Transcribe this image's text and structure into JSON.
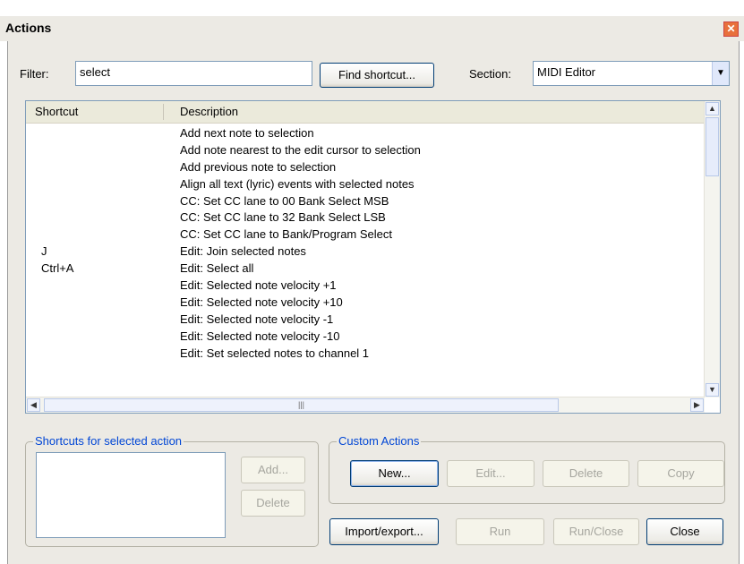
{
  "window": {
    "title": "Actions",
    "close_glyph": "✕"
  },
  "filter": {
    "label": "Filter:",
    "value": "select"
  },
  "find_shortcut_label": "Find shortcut...",
  "section": {
    "label": "Section:",
    "value": "MIDI Editor"
  },
  "table": {
    "columns": [
      "Shortcut",
      "Description"
    ],
    "rows": [
      {
        "shortcut": "",
        "description": "Add next note to selection"
      },
      {
        "shortcut": "",
        "description": "Add note nearest to the edit cursor to selection"
      },
      {
        "shortcut": "",
        "description": "Add previous note to selection"
      },
      {
        "shortcut": "",
        "description": "Align all text (lyric) events with selected notes"
      },
      {
        "shortcut": "",
        "description": "CC: Set CC lane to 00 Bank Select MSB"
      },
      {
        "shortcut": "",
        "description": "CC: Set CC lane to 32 Bank Select LSB"
      },
      {
        "shortcut": "",
        "description": "CC: Set CC lane to Bank/Program Select"
      },
      {
        "shortcut": "J",
        "description": "Edit: Join selected notes"
      },
      {
        "shortcut": "Ctrl+A",
        "description": "Edit: Select all"
      },
      {
        "shortcut": "",
        "description": "Edit: Selected note velocity +1"
      },
      {
        "shortcut": "",
        "description": "Edit: Selected note velocity +10"
      },
      {
        "shortcut": "",
        "description": "Edit: Selected note velocity -1"
      },
      {
        "shortcut": "",
        "description": "Edit: Selected note velocity -10"
      },
      {
        "shortcut": "",
        "description": "Edit: Set selected notes to channel 1"
      }
    ]
  },
  "shortcuts_group": {
    "title": "Shortcuts for selected action",
    "add_label": "Add...",
    "delete_label": "Delete"
  },
  "custom_group": {
    "title": "Custom Actions",
    "new_label": "New...",
    "edit_label": "Edit...",
    "delete_label": "Delete",
    "copy_label": "Copy"
  },
  "footer": {
    "import_export_label": "Import/export...",
    "run_label": "Run",
    "run_close_label": "Run/Close",
    "close_label": "Close"
  },
  "icons": {
    "dropdown": "chevron-down-icon",
    "scroll_up": "scroll-up-icon",
    "scroll_down": "scroll-down-icon",
    "scroll_left": "scroll-left-icon",
    "scroll_right": "scroll-right-icon"
  }
}
